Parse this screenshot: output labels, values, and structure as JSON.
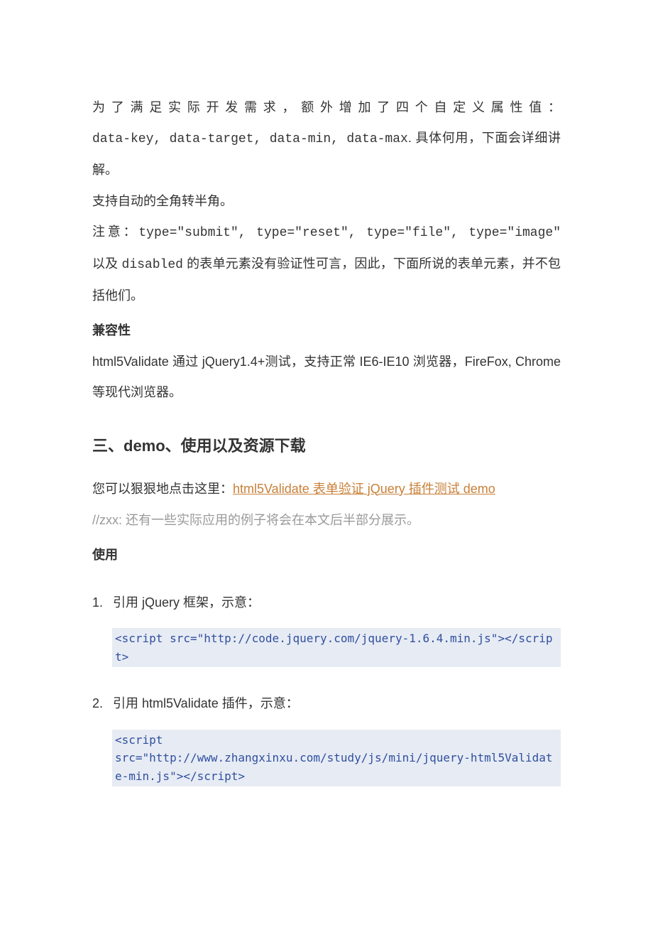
{
  "paragraphs": {
    "p1_line1": "为了满足实际开发需求，额外增加了四个自定义属性值：",
    "p1_line2a": "data-key, data-target, data-min, data-max",
    "p1_line2b": ". 具体何用，下面会详细讲解。",
    "p2": "支持自动的全角转半角。",
    "p3a": "注意：",
    "p3b": "type=\"submit\", type=\"reset\", type=\"file\", type=\"image\"",
    "p3c": " 以及 ",
    "p3d": "disabled",
    "p3e": " 的表单元素没有验证性可言，因此，下面所说的表单元素，并不包括他们。",
    "h_compat": "兼容性",
    "p4": "html5Validate 通过 jQuery1.4+测试，支持正常 IE6-IE10 浏览器，FireFox, Chrome 等现代浏览器。"
  },
  "section3": {
    "heading": "三、demo、使用以及资源下载",
    "intro_pre": "您可以狠狠地点击这里：",
    "intro_link": "html5Validate 表单验证 jQuery 插件测试 demo",
    "note": "//zxx: 还有一些实际应用的例子将会在本文后半部分展示。",
    "h_usage": "使用"
  },
  "steps": {
    "s1_num": "1.",
    "s1_text": " 引用 jQuery 框架，示意：",
    "s1_code": "<script src=\"http://code.jquery.com/jquery-1.6.4.min.js\"></script>",
    "s2_num": "2.",
    "s2_text": " 引用 html5Validate 插件，示意：",
    "s2_code": "<script\nsrc=\"http://www.zhangxinxu.com/study/js/mini/jquery-html5Validate-min.js\"></script>"
  }
}
